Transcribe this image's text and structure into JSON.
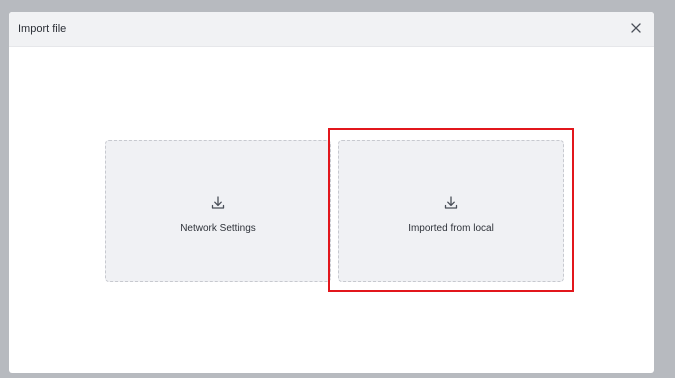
{
  "dialog": {
    "title": "Import file",
    "close_icon": "close-icon"
  },
  "options": [
    {
      "label": "Network Settings",
      "icon": "download-icon"
    },
    {
      "label": "Imported from local",
      "icon": "download-icon"
    }
  ],
  "colors": {
    "backdrop": "#b7babf",
    "header": "#f1f2f4",
    "card": "#f0f1f4",
    "highlight": "#e2161c"
  }
}
